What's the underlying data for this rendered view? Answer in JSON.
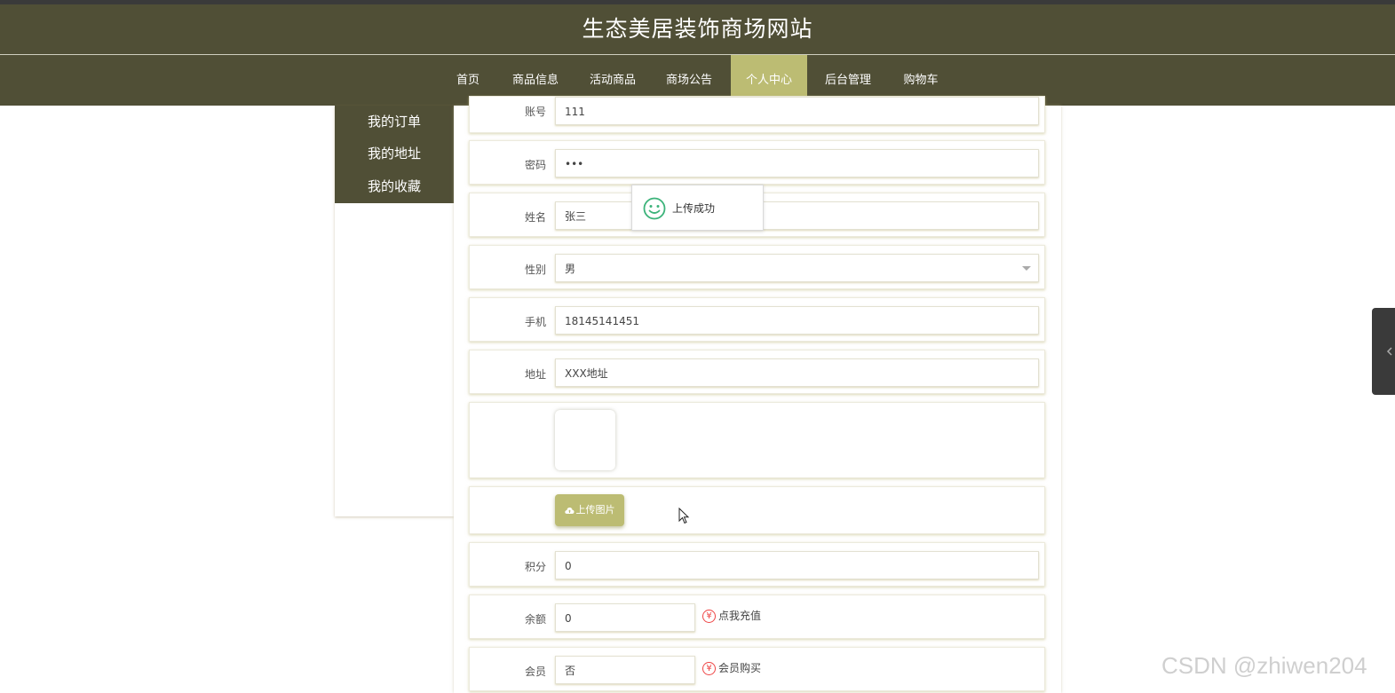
{
  "site": {
    "title": "生态美居装饰商场网站"
  },
  "nav": {
    "items": [
      {
        "label": "首页",
        "active": false
      },
      {
        "label": "商品信息",
        "active": false
      },
      {
        "label": "活动商品",
        "active": false
      },
      {
        "label": "商场公告",
        "active": false
      },
      {
        "label": "个人中心",
        "active": true
      },
      {
        "label": "后台管理",
        "active": false
      },
      {
        "label": "购物车",
        "active": false
      }
    ]
  },
  "sidebar": {
    "items": [
      {
        "label": "我的订单"
      },
      {
        "label": "我的地址"
      },
      {
        "label": "我的收藏"
      }
    ]
  },
  "form": {
    "account": {
      "label": "账号",
      "value": "111"
    },
    "password": {
      "label": "密码",
      "value": "•••"
    },
    "name": {
      "label": "姓名",
      "value": "张三"
    },
    "gender": {
      "label": "性别",
      "value": "男"
    },
    "phone": {
      "label": "手机",
      "value": "18145141451"
    },
    "address": {
      "label": "地址",
      "value": "XXX地址"
    },
    "upload": {
      "button_label": "上传图片"
    },
    "points": {
      "label": "积分",
      "value": "0"
    },
    "balance": {
      "label": "余额",
      "value": "0",
      "link": "点我充值"
    },
    "member": {
      "label": "会员",
      "value": "否",
      "link": "会员购买"
    }
  },
  "toast": {
    "message": "上传成功",
    "icon": "smile-icon"
  },
  "watermark": "CSDN @zhiwen204",
  "colors": {
    "primary": "#504f36",
    "accent": "#bcbc73",
    "success": "#3cb37a",
    "danger": "#e44444"
  }
}
